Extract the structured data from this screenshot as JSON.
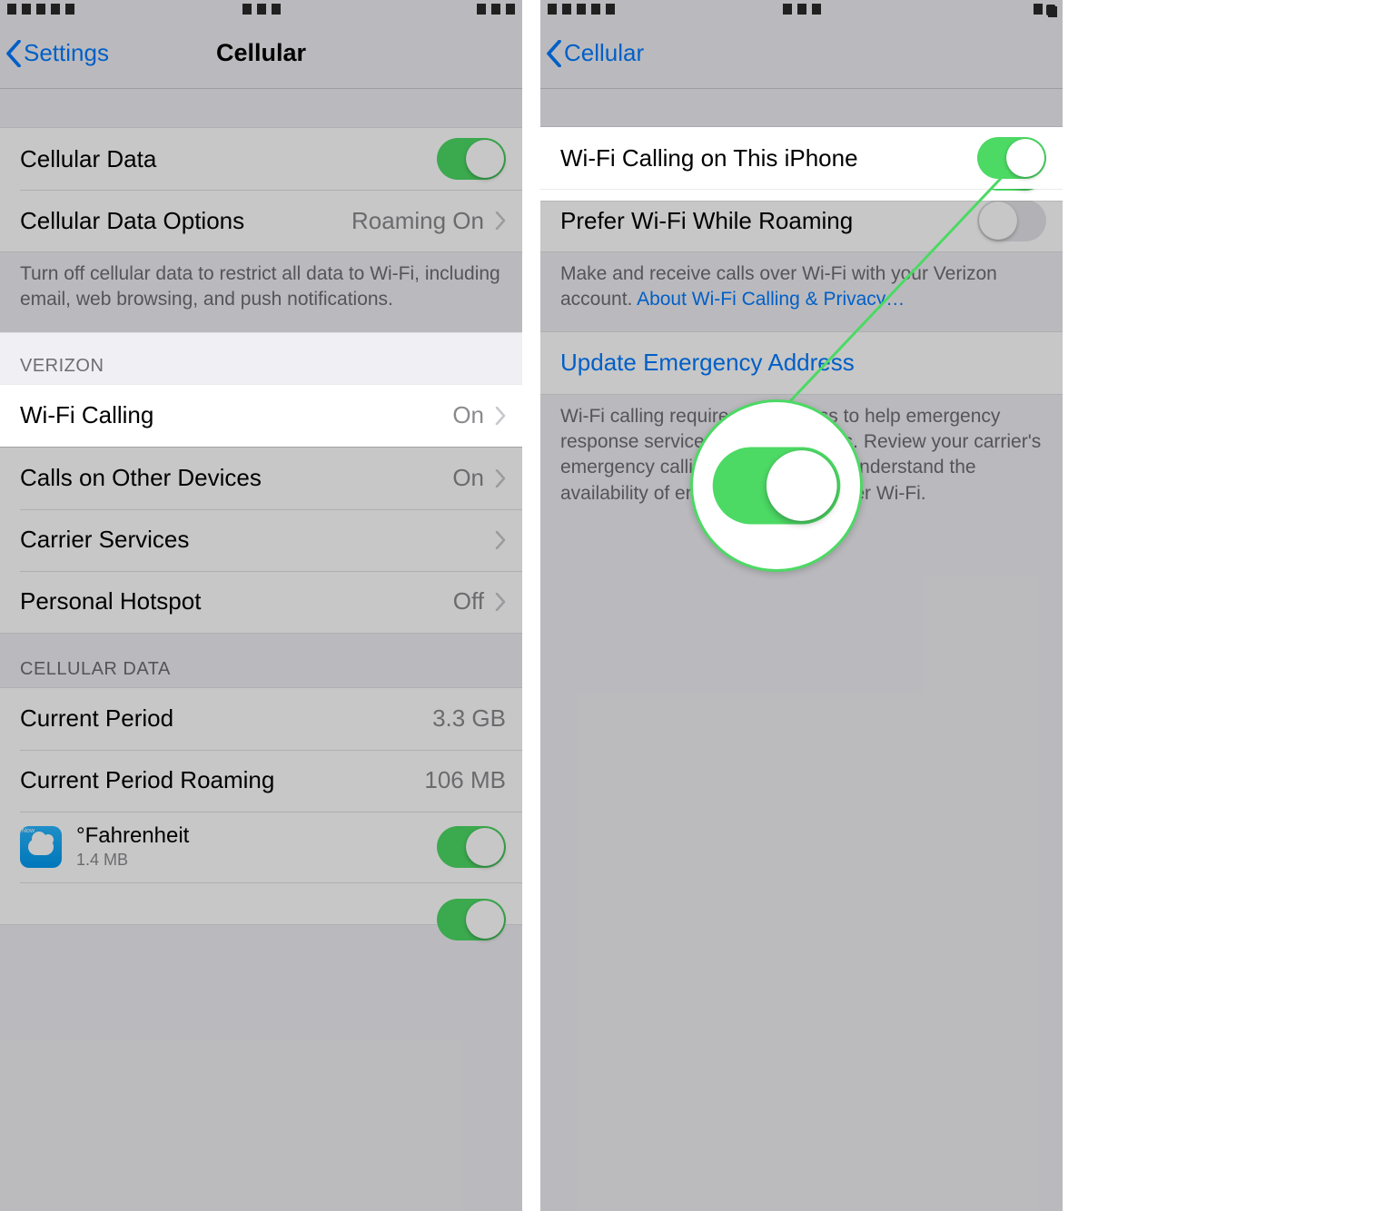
{
  "left": {
    "nav": {
      "back": "Settings",
      "title": "Cellular"
    },
    "cellular_data": {
      "label": "Cellular Data",
      "on": true
    },
    "cellular_data_options": {
      "label": "Cellular Data Options",
      "value": "Roaming On"
    },
    "note1": "Turn off cellular data to restrict all data to Wi-Fi, including email, web browsing, and push notifications.",
    "carrier_section_header": "VERIZON",
    "wifi_calling": {
      "label": "Wi-Fi Calling",
      "value": "On"
    },
    "calls_other": {
      "label": "Calls on Other Devices",
      "value": "On"
    },
    "carrier_services": {
      "label": "Carrier Services"
    },
    "personal_hotspot": {
      "label": "Personal Hotspot",
      "value": "Off"
    },
    "usage_header": "CELLULAR DATA",
    "current_period": {
      "label": "Current Period",
      "value": "3.3 GB"
    },
    "current_period_roaming": {
      "label": "Current Period Roaming",
      "value": "106 MB"
    },
    "app1": {
      "name": "°Fahrenheit",
      "usage": "1.4 MB",
      "on": true,
      "icon_tag": "Now"
    }
  },
  "right": {
    "nav": {
      "back": "Cellular"
    },
    "wifi_on_iphone": {
      "label": "Wi-Fi Calling on This iPhone",
      "on": true
    },
    "prefer_roam": {
      "label": "Prefer Wi-Fi While Roaming",
      "on": false
    },
    "note_account": {
      "text": "Make and receive calls over Wi-Fi with your Verizon account. ",
      "link": "About Wi-Fi Calling & Privacy…"
    },
    "update_emergency": "Update Emergency Address",
    "note_emergency": "Wi-Fi calling requires an address to help emergency response services respond to calls. Review your carrier's emergency calling terms below to understand the availability of emergency calling over Wi-Fi."
  },
  "colors": {
    "ios_green": "#4cd964",
    "ios_blue": "#007aff",
    "ios_gray": "#8a8a8e"
  }
}
